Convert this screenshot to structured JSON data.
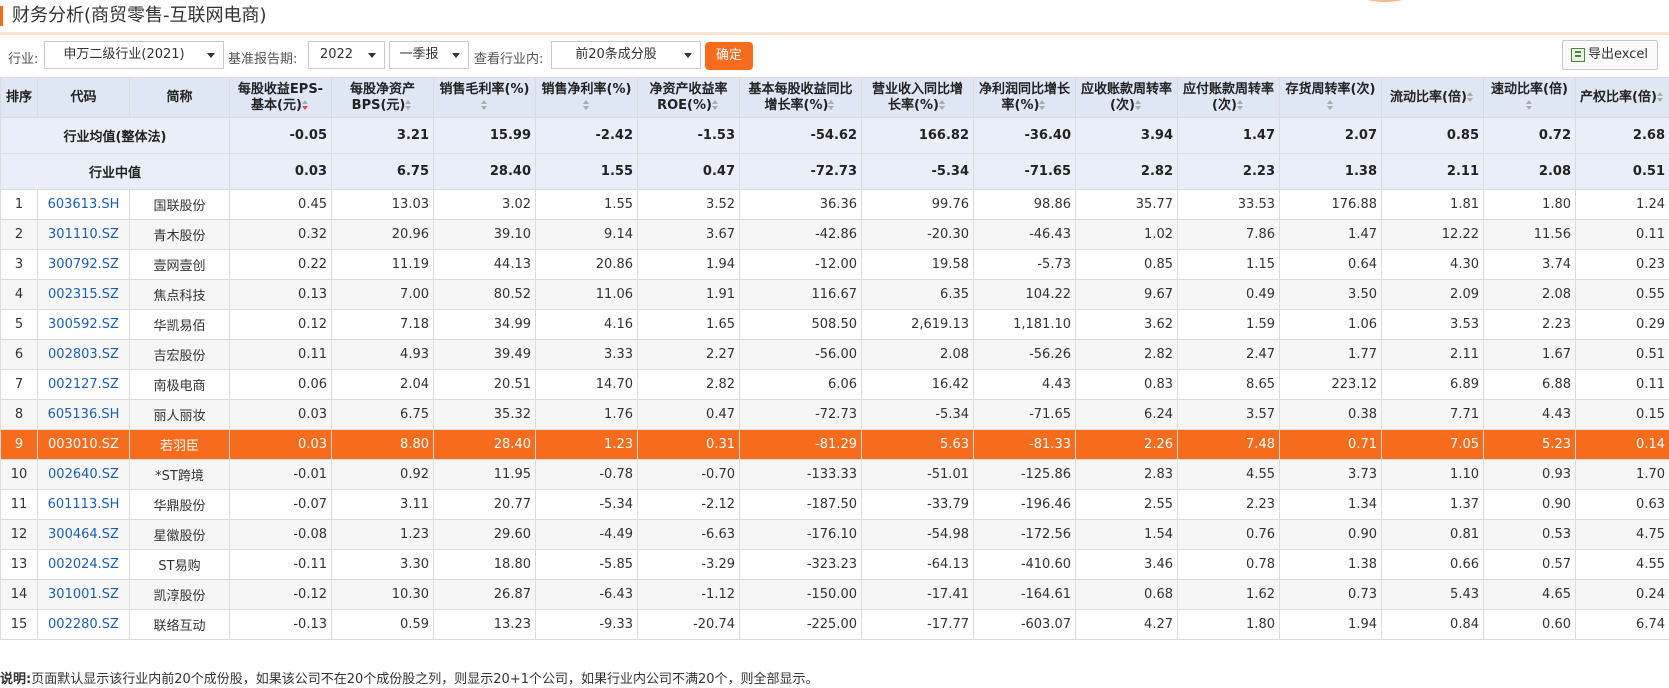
{
  "title": "财务分析(商贸零售-互联网电商)",
  "toolbar": {
    "industry_label": "行业:",
    "industry_value": "申万二级行业(2021)",
    "period_label": "基准报告期:",
    "year_value": "2022",
    "quarter_value": "一季报",
    "scope_label": "查看行业内:",
    "scope_value": "前20条成分股",
    "ok_label": "确定",
    "export_label": "导出excel"
  },
  "columns": [
    "排序",
    "代码",
    "简称",
    "每股收益EPS-基本(元)",
    "每股净资产BPS(元)",
    "销售毛利率(%)",
    "销售净利率(%)",
    "净资产收益率ROE(%)",
    "基本每股收益同比增长率(%)",
    "营业收入同比增长率(%)",
    "净利润同比增长率(%)",
    "应收账款周转率(次)",
    "应付账款周转率(次)",
    "存货周转率(次)",
    "流动比率(倍)",
    "速动比率(倍)",
    "产权比率(倍)"
  ],
  "summary": [
    {
      "label": "行业均值(整体法)",
      "values": [
        "-0.05",
        "3.21",
        "15.99",
        "-2.42",
        "-1.53",
        "-54.62",
        "166.82",
        "-36.40",
        "3.94",
        "1.47",
        "2.07",
        "0.85",
        "0.72",
        "2.68"
      ]
    },
    {
      "label": "行业中值",
      "values": [
        "0.03",
        "6.75",
        "28.40",
        "1.55",
        "0.47",
        "-72.73",
        "-5.34",
        "-71.65",
        "2.82",
        "2.23",
        "1.38",
        "2.11",
        "2.08",
        "0.51"
      ]
    }
  ],
  "rows": [
    {
      "rank": "1",
      "code": "603613.SH",
      "name": "国联股份",
      "values": [
        "0.45",
        "13.03",
        "3.02",
        "1.55",
        "3.52",
        "36.36",
        "99.76",
        "98.86",
        "35.77",
        "33.53",
        "176.88",
        "1.81",
        "1.80",
        "1.24"
      ]
    },
    {
      "rank": "2",
      "code": "301110.SZ",
      "name": "青木股份",
      "values": [
        "0.32",
        "20.96",
        "39.10",
        "9.14",
        "3.67",
        "-42.86",
        "-20.30",
        "-46.43",
        "1.02",
        "7.86",
        "1.47",
        "12.22",
        "11.56",
        "0.11"
      ]
    },
    {
      "rank": "3",
      "code": "300792.SZ",
      "name": "壹网壹创",
      "values": [
        "0.22",
        "11.19",
        "44.13",
        "20.86",
        "1.94",
        "-12.00",
        "19.58",
        "-5.73",
        "0.85",
        "1.15",
        "0.64",
        "4.30",
        "3.74",
        "0.23"
      ]
    },
    {
      "rank": "4",
      "code": "002315.SZ",
      "name": "焦点科技",
      "values": [
        "0.13",
        "7.00",
        "80.52",
        "11.06",
        "1.91",
        "116.67",
        "6.35",
        "104.22",
        "9.67",
        "0.49",
        "3.50",
        "2.09",
        "2.08",
        "0.55"
      ]
    },
    {
      "rank": "5",
      "code": "300592.SZ",
      "name": "华凯易佰",
      "values": [
        "0.12",
        "7.18",
        "34.99",
        "4.16",
        "1.65",
        "508.50",
        "2,619.13",
        "1,181.10",
        "3.62",
        "1.59",
        "1.06",
        "3.53",
        "2.23",
        "0.29"
      ]
    },
    {
      "rank": "6",
      "code": "002803.SZ",
      "name": "吉宏股份",
      "values": [
        "0.11",
        "4.93",
        "39.49",
        "3.33",
        "2.27",
        "-56.00",
        "2.08",
        "-56.26",
        "2.82",
        "2.47",
        "1.77",
        "2.11",
        "1.67",
        "0.51"
      ]
    },
    {
      "rank": "7",
      "code": "002127.SZ",
      "name": "南极电商",
      "values": [
        "0.06",
        "2.04",
        "20.51",
        "14.70",
        "2.82",
        "6.06",
        "16.42",
        "4.43",
        "0.83",
        "8.65",
        "223.12",
        "6.89",
        "6.88",
        "0.11"
      ]
    },
    {
      "rank": "8",
      "code": "605136.SH",
      "name": "丽人丽妆",
      "values": [
        "0.03",
        "6.75",
        "35.32",
        "1.76",
        "0.47",
        "-72.73",
        "-5.34",
        "-71.65",
        "6.24",
        "3.57",
        "0.38",
        "7.71",
        "4.43",
        "0.15"
      ]
    },
    {
      "rank": "9",
      "code": "003010.SZ",
      "name": "若羽臣",
      "highlight": true,
      "values": [
        "0.03",
        "8.80",
        "28.40",
        "1.23",
        "0.31",
        "-81.29",
        "5.63",
        "-81.33",
        "2.26",
        "7.48",
        "0.71",
        "7.05",
        "5.23",
        "0.14"
      ]
    },
    {
      "rank": "10",
      "code": "002640.SZ",
      "name": "*ST跨境",
      "values": [
        "-0.01",
        "0.92",
        "11.95",
        "-0.78",
        "-0.70",
        "-133.33",
        "-51.01",
        "-125.86",
        "2.83",
        "4.55",
        "3.73",
        "1.10",
        "0.93",
        "1.70"
      ]
    },
    {
      "rank": "11",
      "code": "601113.SH",
      "name": "华鼎股份",
      "values": [
        "-0.07",
        "3.11",
        "20.77",
        "-5.34",
        "-2.12",
        "-187.50",
        "-33.79",
        "-196.46",
        "2.55",
        "2.23",
        "1.34",
        "1.37",
        "0.90",
        "0.63"
      ]
    },
    {
      "rank": "12",
      "code": "300464.SZ",
      "name": "星徽股份",
      "values": [
        "-0.08",
        "1.23",
        "29.60",
        "-4.49",
        "-6.63",
        "-176.10",
        "-54.98",
        "-172.56",
        "1.54",
        "0.76",
        "0.90",
        "0.81",
        "0.53",
        "4.75"
      ]
    },
    {
      "rank": "13",
      "code": "002024.SZ",
      "name": "ST易购",
      "values": [
        "-0.11",
        "3.30",
        "18.80",
        "-5.85",
        "-3.29",
        "-323.23",
        "-64.13",
        "-410.60",
        "3.46",
        "0.78",
        "1.38",
        "0.66",
        "0.57",
        "4.55"
      ]
    },
    {
      "rank": "14",
      "code": "301001.SZ",
      "name": "凯淳股份",
      "values": [
        "-0.12",
        "10.30",
        "26.87",
        "-6.43",
        "-1.12",
        "-150.00",
        "-17.41",
        "-164.61",
        "0.68",
        "1.62",
        "0.73",
        "5.43",
        "4.65",
        "0.24"
      ]
    },
    {
      "rank": "15",
      "code": "002280.SZ",
      "name": "联络互动",
      "values": [
        "-0.13",
        "0.59",
        "13.23",
        "-9.33",
        "-20.74",
        "-225.00",
        "-17.77",
        "-603.07",
        "4.27",
        "1.80",
        "1.94",
        "0.84",
        "0.60",
        "6.74"
      ]
    }
  ],
  "note_label": "说明:",
  "note_text": "页面默认显示该行业内前20个成份股，如果该公司不在20个成份股之列，则显示20+1个公司，如果行业内公司不满20个，则全部显示。"
}
